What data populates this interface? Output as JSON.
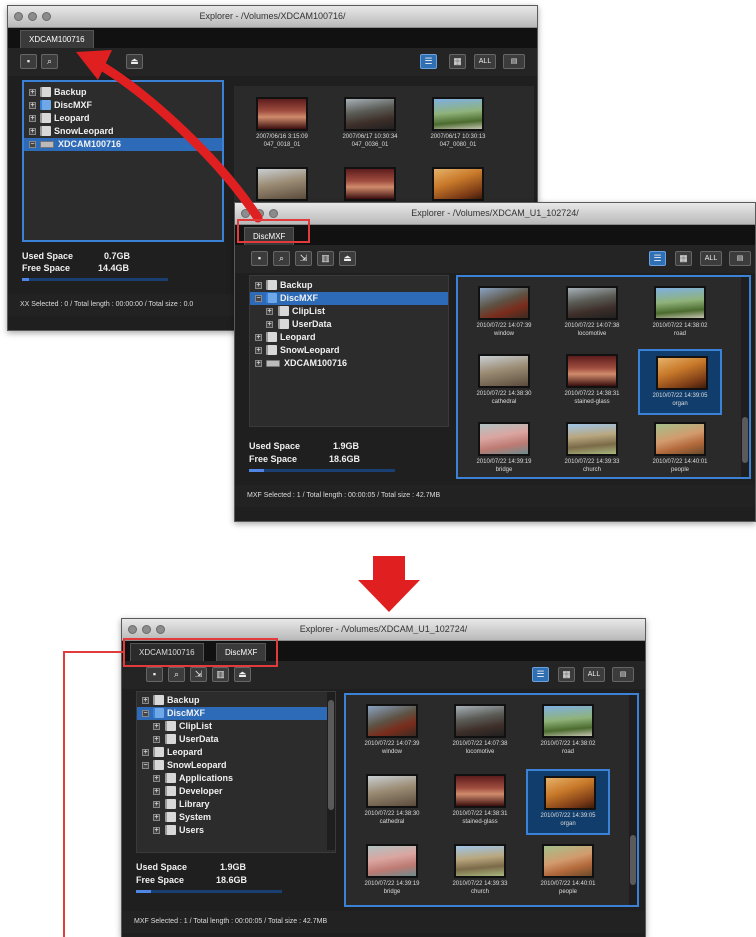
{
  "win1": {
    "title": "Explorer - /Volumes/XDCAM100716/",
    "tab_label": "XDCAM100716",
    "tree": [
      "Backup",
      "DiscMXF",
      "Leopard",
      "SnowLeopard",
      "XDCAM100716"
    ],
    "used_label": "Used Space",
    "used_value": "0.7GB",
    "free_label": "Free Space",
    "free_value": "14.4GB",
    "status": "XX  Selected : 0 / Total length : 00:00:00 / Total size : 0.0",
    "thumbs": [
      {
        "date": "2007/06/16 3:15:09",
        "name": "047_0018_01"
      },
      {
        "date": "2007/06/17 10:30:34",
        "name": "047_0036_01"
      },
      {
        "date": "2007/06/17 10:30:13",
        "name": "047_0080_01"
      }
    ]
  },
  "win2": {
    "title": "Explorer - /Volumes/XDCAM_U1_102724/",
    "tab_label": "DiscMXF",
    "tree": [
      "Backup",
      "DiscMXF",
      "ClipList",
      "UserData",
      "Leopard",
      "SnowLeopard",
      "XDCAM100716"
    ],
    "used_label": "Used Space",
    "used_value": "1.9GB",
    "free_label": "Free Space",
    "free_value": "18.6GB",
    "status": "MXF  Selected : 1 / Total length : 00:00:05 / Total size : 42.7MB",
    "thumbs": [
      {
        "date": "2010/07/22 14:07:39",
        "name": "window"
      },
      {
        "date": "2010/07/22 14:07:38",
        "name": "locomotive"
      },
      {
        "date": "2010/07/22 14:38:02",
        "name": "road"
      },
      {
        "date": "2010/07/22 14:38:30",
        "name": "cathedral"
      },
      {
        "date": "2010/07/22 14:38:31",
        "name": "stained-glass"
      },
      {
        "date": "2010/07/22 14:39:05",
        "name": "organ"
      },
      {
        "date": "2010/07/22 14:39:19",
        "name": "bridge"
      },
      {
        "date": "2010/07/22 14:39:33",
        "name": "church"
      },
      {
        "date": "2010/07/22 14:40:01",
        "name": "people"
      }
    ]
  },
  "win3": {
    "title": "Explorer - /Volumes/XDCAM_U1_102724/",
    "tab1_label": "XDCAM100716",
    "tab2_label": "DiscMXF",
    "tree": [
      "Backup",
      "DiscMXF",
      "ClipList",
      "UserData",
      "Leopard",
      "SnowLeopard",
      "Applications",
      "Developer",
      "Library",
      "System",
      "Users"
    ],
    "used_label": "Used Space",
    "used_value": "1.9GB",
    "free_label": "Free Space",
    "free_value": "18.6GB",
    "status": "MXF  Selected : 1 / Total length : 00:00:05 / Total size : 42.7MB",
    "thumbs": [
      {
        "date": "2010/07/22 14:07:39",
        "name": "window"
      },
      {
        "date": "2010/07/22 14:07:38",
        "name": "locomotive"
      },
      {
        "date": "2010/07/22 14:38:02",
        "name": "road"
      },
      {
        "date": "2010/07/22 14:38:30",
        "name": "cathedral"
      },
      {
        "date": "2010/07/22 14:38:31",
        "name": "stained-glass"
      },
      {
        "date": "2010/07/22 14:39:05",
        "name": "organ"
      },
      {
        "date": "2010/07/22 14:39:19",
        "name": "bridge"
      },
      {
        "date": "2010/07/22 14:39:33",
        "name": "church"
      },
      {
        "date": "2010/07/22 14:40:01",
        "name": "people"
      }
    ]
  },
  "toolbar": {
    "all_label": "ALL"
  },
  "colors": {
    "arrow": "#e02020",
    "selection": "#2d6bb8",
    "focus": "#3b82d6",
    "highlight_box": "#e23b3b"
  }
}
